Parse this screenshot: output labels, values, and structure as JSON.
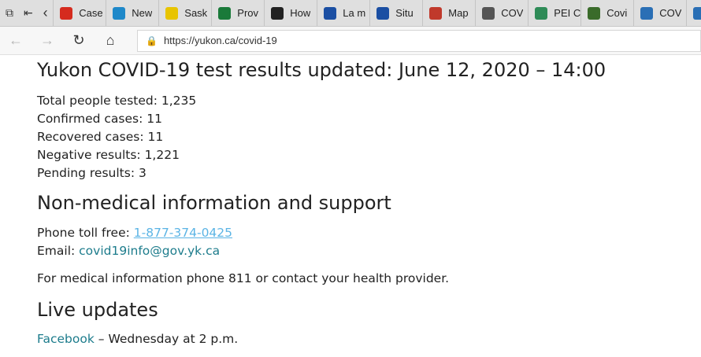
{
  "browser": {
    "tabs": [
      {
        "label": "Case",
        "favicon": "ca-flag-icon",
        "color": "#d52b1e"
      },
      {
        "label": "New",
        "favicon": "alberta-icon",
        "color": "#1e88c9"
      },
      {
        "label": "Sask",
        "favicon": "saskatchewan-icon",
        "color": "#e8c400"
      },
      {
        "label": "Prov",
        "favicon": "manitoba-icon",
        "color": "#1a7a3a"
      },
      {
        "label": "How",
        "favicon": "ontario-icon",
        "color": "#222222"
      },
      {
        "label": "La m",
        "favicon": "quebec-icon",
        "color": "#1b4fa3"
      },
      {
        "label": "Situ",
        "favicon": "quebec-icon",
        "color": "#1b4fa3"
      },
      {
        "label": "Map",
        "favicon": "new-brunswick-icon",
        "color": "#c0392b"
      },
      {
        "label": "COV",
        "favicon": "nova-scotia-icon",
        "color": "#555555"
      },
      {
        "label": "PEI C",
        "favicon": "pei-icon",
        "color": "#2e8b57"
      },
      {
        "label": "Covi",
        "favicon": "nl-icon",
        "color": "#3a6b2a"
      },
      {
        "label": "COV",
        "favicon": "nwt-icon",
        "color": "#2a6fb5"
      }
    ],
    "url": "https://yukon.ca/covid-19"
  },
  "page": {
    "title": "Yukon COVID-19 test results updated: June 12, 2020 – 14:00",
    "stats": [
      "Total people tested: 1,235",
      "Confirmed cases: 11",
      "Recovered cases: 11",
      "Negative results: 1,221",
      "Pending results: 3"
    ],
    "support_heading": "Non-medical information and support",
    "phone_label": "Phone toll free: ",
    "phone": "1-877-374-0425",
    "email_label": "Email: ",
    "email": "covid19info@gov.yk.ca",
    "medical_note": "For medical information phone 811 or contact your health provider.",
    "live_heading": "Live updates",
    "facebook_link": "Facebook",
    "facebook_schedule": " – Wednesday at 2 p.m."
  },
  "colors": {
    "link_phone": "#5bb4e5",
    "link_default": "#1d7c8c"
  }
}
